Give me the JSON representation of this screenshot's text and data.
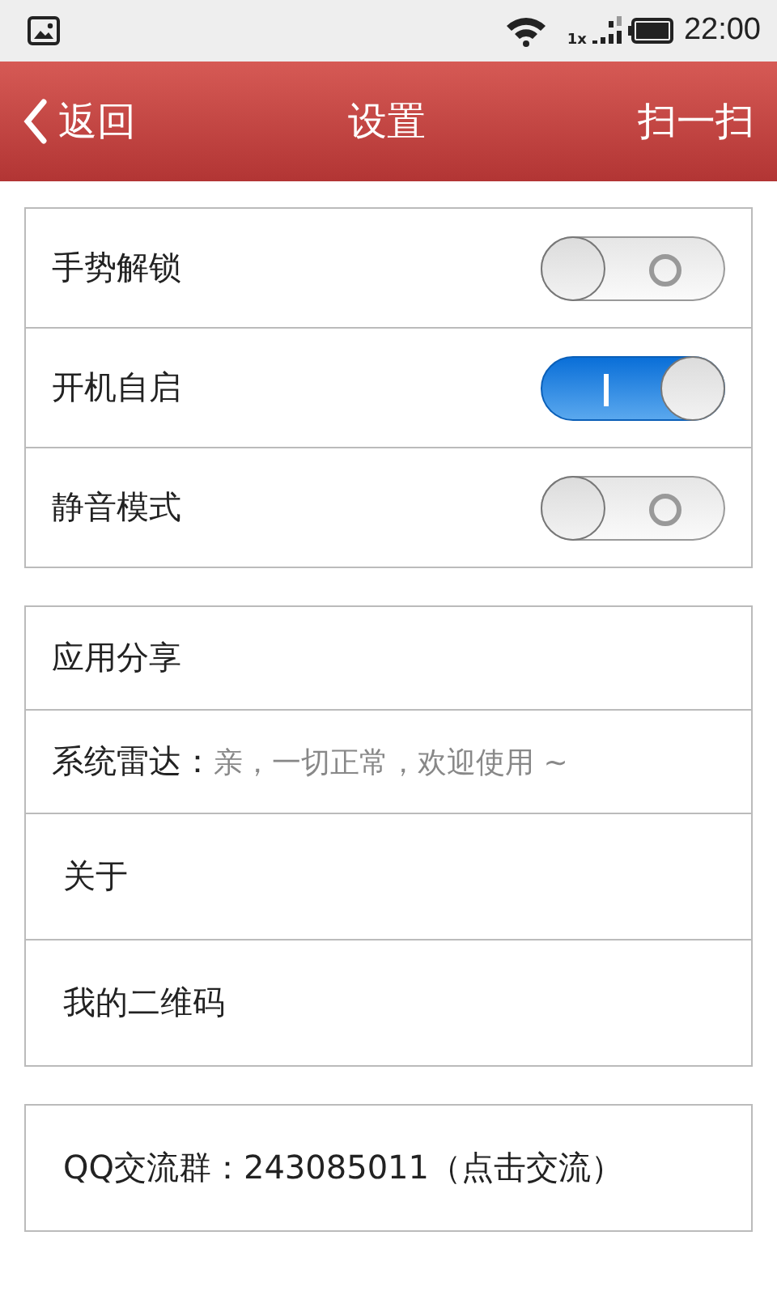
{
  "status_bar": {
    "network": "1x",
    "time": "22:00"
  },
  "header": {
    "back": "返回",
    "title": "设置",
    "action": "扫一扫"
  },
  "groups": [
    {
      "items": [
        {
          "kind": "toggle",
          "label": "手势解锁",
          "on": false
        },
        {
          "kind": "toggle",
          "label": "开机自启",
          "on": true
        },
        {
          "kind": "toggle",
          "label": "静音模式",
          "on": false
        }
      ]
    },
    {
      "items": [
        {
          "kind": "link",
          "label": "应用分享"
        },
        {
          "kind": "status",
          "label": "系统雷达：",
          "value": "亲，一切正常，欢迎使用 ~"
        },
        {
          "kind": "link",
          "label": "关于"
        },
        {
          "kind": "link",
          "label": "我的二维码"
        }
      ]
    },
    {
      "items": [
        {
          "kind": "link",
          "label": "QQ交流群：243085011（点击交流）"
        }
      ]
    }
  ]
}
